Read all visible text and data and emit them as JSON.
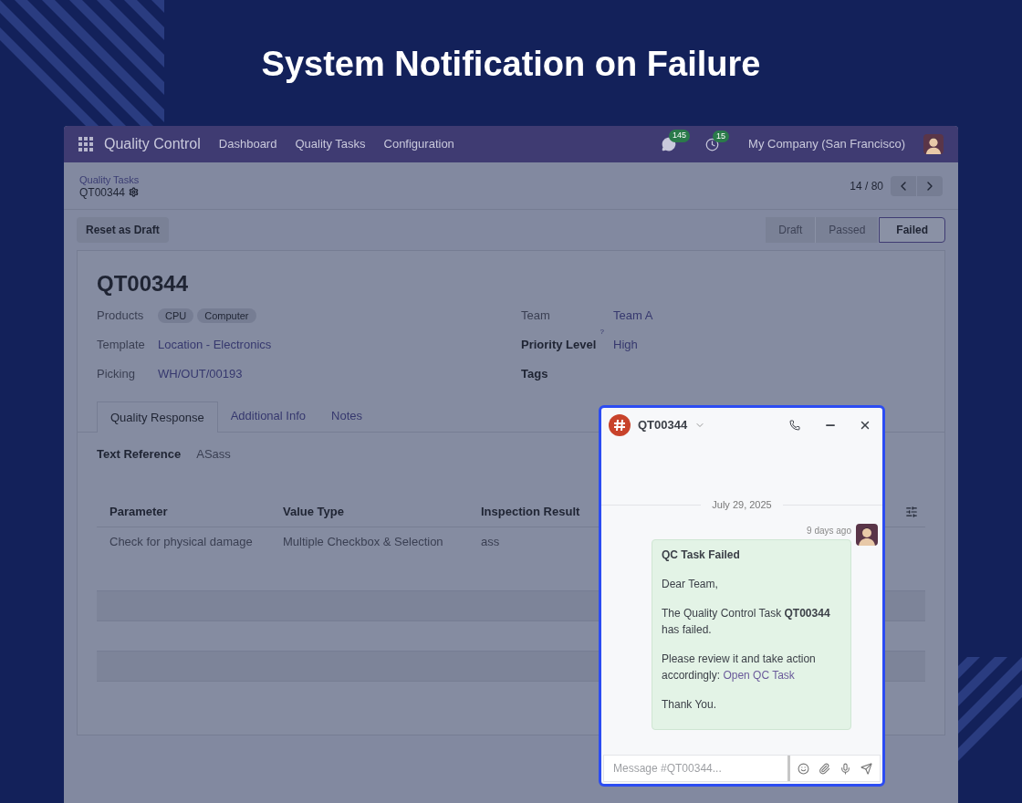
{
  "page_title": "System Notification on Failure",
  "navbar": {
    "app_name": "Quality Control",
    "menu": [
      "Dashboard",
      "Quality Tasks",
      "Configuration"
    ],
    "messages_count": "145",
    "activities_count": "15",
    "company": "My Company (San Francisco)"
  },
  "breadcrumb": {
    "parent": "Quality Tasks",
    "current": "QT00344"
  },
  "pager": "14 / 80",
  "actions": [
    "Reset as Draft"
  ],
  "stages": [
    {
      "label": "Draft",
      "selected": false
    },
    {
      "label": "Passed",
      "selected": false
    },
    {
      "label": "Failed",
      "selected": true
    }
  ],
  "record": {
    "title": "QT00344",
    "left_fields": [
      {
        "label": "Products",
        "kind": "tags",
        "tags": [
          "CPU",
          "Computer"
        ]
      },
      {
        "label": "Template",
        "kind": "link",
        "value": "Location - Electronics"
      },
      {
        "label": "Picking",
        "kind": "link",
        "value": "WH/OUT/00193"
      }
    ],
    "right_fields": [
      {
        "label": "Team",
        "bold": false,
        "value": "Team A"
      },
      {
        "label": "Priority Level",
        "bold": true,
        "help": "?",
        "value": "High"
      },
      {
        "label": "Tags",
        "bold": true
      }
    ]
  },
  "tabs": [
    {
      "label": "Quality Response",
      "selected": true
    },
    {
      "label": "Additional Info",
      "selected": false
    },
    {
      "label": "Notes",
      "selected": false
    }
  ],
  "text_reference": {
    "label": "Text Reference",
    "value": "ASass"
  },
  "table": {
    "columns": [
      "Parameter",
      "Value Type",
      "Inspection Result"
    ],
    "rows": [
      [
        "Check for physical damage",
        "Multiple Checkbox & Selection",
        "ass"
      ]
    ]
  },
  "chat": {
    "title": "QT00344",
    "date": "July 29, 2025",
    "time": "9 days ago",
    "message": {
      "subject": "QC Task Failed",
      "paragraphs": [
        "Dear Team,",
        "The Quality Control Task **QT00344** has failed."
      ],
      "action_text": "Please review it and take action accordingly:",
      "link": "Open QC Task",
      "closing": "Thank You."
    },
    "placeholder": "Message #QT00344..."
  }
}
